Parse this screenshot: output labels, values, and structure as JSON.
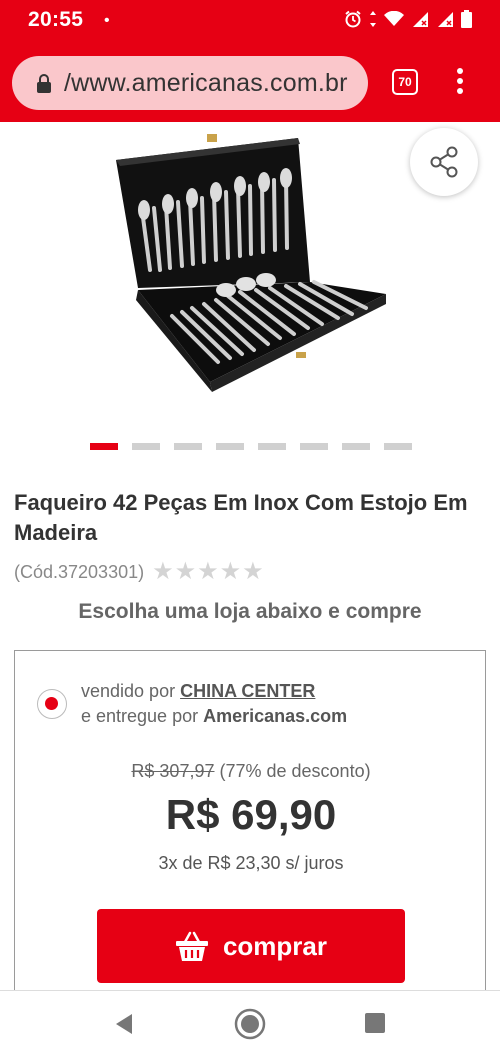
{
  "status_bar": {
    "time": "20:55",
    "dot": "•"
  },
  "browser": {
    "url": "/www.americanas.com.br",
    "tab_count": "70"
  },
  "product": {
    "title": "Faqueiro 42 Peças Em Inox Com Estojo Em Madeira",
    "code": "(Cód.37203301)",
    "rating": 0,
    "max_rating": 5,
    "carousel": {
      "total": 8,
      "active_index": 0
    }
  },
  "choose_store": "Escolha uma loja abaixo e compre",
  "offer": {
    "sold_by_prefix": "vendido por ",
    "seller": "CHINA CENTER",
    "delivered_prefix": "e entregue por ",
    "delivered_by": "Americanas.com",
    "old_price": "R$ 307,97",
    "discount": " (77% de desconto)",
    "price": "R$ 69,90",
    "installments": "3x de R$ 23,30 s/ juros",
    "buy_label": "comprar"
  },
  "colors": {
    "brand": "#e60014",
    "text": "#333333"
  },
  "icons": {
    "lock": "lock-icon",
    "share": "share-icon",
    "basket": "basket-icon",
    "menu": "more-vertical-icon"
  }
}
